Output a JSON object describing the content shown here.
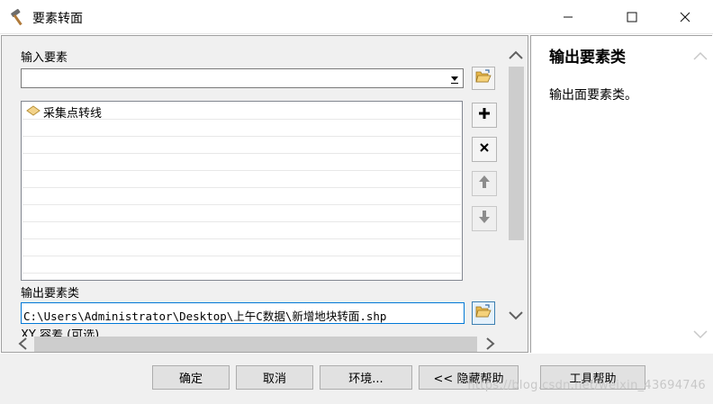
{
  "window": {
    "title": "要素转面"
  },
  "input": {
    "label": "输入要素",
    "combo_value": "",
    "list_items": [
      "采集点转线"
    ]
  },
  "output": {
    "label": "输出要素类",
    "value": "C:\\Users\\Administrator\\Desktop\\上午C数据\\新增地块转面.shp"
  },
  "cut_label": "XY 容差 (可选)",
  "help": {
    "title": "输出要素类",
    "description": "输出面要素类。"
  },
  "buttons": {
    "ok": "确定",
    "cancel": "取消",
    "environments": "环境...",
    "hide_help": "<< 隐藏帮助",
    "tool_help": "工具帮助"
  },
  "watermark": "https://blog.csdn.net/weixin_43694746"
}
